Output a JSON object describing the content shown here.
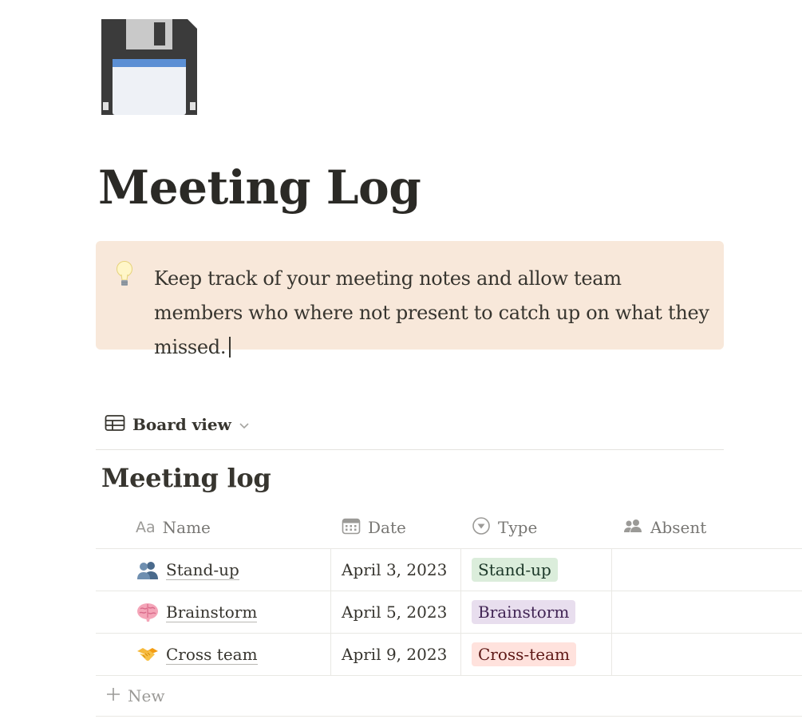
{
  "page": {
    "icon": "floppy-disk-icon",
    "title": "Meeting Log"
  },
  "callout": {
    "icon": "lightbulb-icon",
    "text": "Keep track of your meeting notes and allow team members who where not present to catch up on what they missed."
  },
  "view": {
    "icon": "table-icon",
    "label": "Board view",
    "dropdown_icon": "chevron-down-icon"
  },
  "database": {
    "title": "Meeting log",
    "columns": [
      {
        "label": "Name",
        "icon": "text-aa-icon"
      },
      {
        "label": "Date",
        "icon": "calendar-icon"
      },
      {
        "label": "Type",
        "icon": "select-icon"
      },
      {
        "label": "Absent",
        "icon": "people-icon"
      }
    ],
    "rows": [
      {
        "name": "Stand-up",
        "emoji": "👥",
        "date": "April 3, 2023",
        "type": "Stand-up",
        "type_color": "#dbeddb",
        "type_text_color": "#1c3829",
        "absent": ""
      },
      {
        "name": "Brainstorm",
        "emoji": "🧠",
        "date": "April 5, 2023",
        "type": "Brainstorm",
        "type_color": "#e8deee",
        "type_text_color": "#412454",
        "absent": ""
      },
      {
        "name": "Cross team",
        "emoji": "🤝",
        "date": "April 9, 2023",
        "type": "Cross-team",
        "type_color": "#ffe2dd",
        "type_text_color": "#5d1715",
        "absent": ""
      }
    ],
    "new_label": "New"
  },
  "colors": {
    "callout_bg": "#f8e8da",
    "text": "#37352f",
    "muted": "#787774"
  }
}
